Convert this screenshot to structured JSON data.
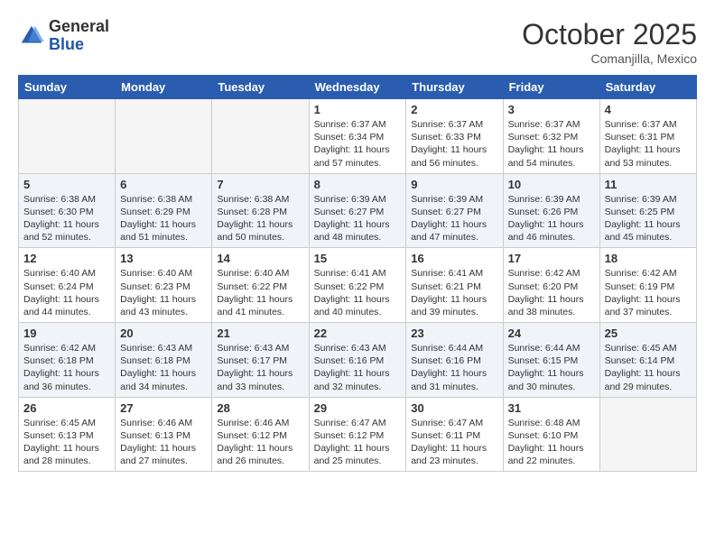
{
  "logo": {
    "general": "General",
    "blue": "Blue"
  },
  "title": "October 2025",
  "subtitle": "Comanjilla, Mexico",
  "weekdays": [
    "Sunday",
    "Monday",
    "Tuesday",
    "Wednesday",
    "Thursday",
    "Friday",
    "Saturday"
  ],
  "weeks": [
    [
      {
        "day": "",
        "sunrise": "",
        "sunset": "",
        "daylight": ""
      },
      {
        "day": "",
        "sunrise": "",
        "sunset": "",
        "daylight": ""
      },
      {
        "day": "",
        "sunrise": "",
        "sunset": "",
        "daylight": ""
      },
      {
        "day": "1",
        "sunrise": "Sunrise: 6:37 AM",
        "sunset": "Sunset: 6:34 PM",
        "daylight": "Daylight: 11 hours and 57 minutes."
      },
      {
        "day": "2",
        "sunrise": "Sunrise: 6:37 AM",
        "sunset": "Sunset: 6:33 PM",
        "daylight": "Daylight: 11 hours and 56 minutes."
      },
      {
        "day": "3",
        "sunrise": "Sunrise: 6:37 AM",
        "sunset": "Sunset: 6:32 PM",
        "daylight": "Daylight: 11 hours and 54 minutes."
      },
      {
        "day": "4",
        "sunrise": "Sunrise: 6:37 AM",
        "sunset": "Sunset: 6:31 PM",
        "daylight": "Daylight: 11 hours and 53 minutes."
      }
    ],
    [
      {
        "day": "5",
        "sunrise": "Sunrise: 6:38 AM",
        "sunset": "Sunset: 6:30 PM",
        "daylight": "Daylight: 11 hours and 52 minutes."
      },
      {
        "day": "6",
        "sunrise": "Sunrise: 6:38 AM",
        "sunset": "Sunset: 6:29 PM",
        "daylight": "Daylight: 11 hours and 51 minutes."
      },
      {
        "day": "7",
        "sunrise": "Sunrise: 6:38 AM",
        "sunset": "Sunset: 6:28 PM",
        "daylight": "Daylight: 11 hours and 50 minutes."
      },
      {
        "day": "8",
        "sunrise": "Sunrise: 6:39 AM",
        "sunset": "Sunset: 6:27 PM",
        "daylight": "Daylight: 11 hours and 48 minutes."
      },
      {
        "day": "9",
        "sunrise": "Sunrise: 6:39 AM",
        "sunset": "Sunset: 6:27 PM",
        "daylight": "Daylight: 11 hours and 47 minutes."
      },
      {
        "day": "10",
        "sunrise": "Sunrise: 6:39 AM",
        "sunset": "Sunset: 6:26 PM",
        "daylight": "Daylight: 11 hours and 46 minutes."
      },
      {
        "day": "11",
        "sunrise": "Sunrise: 6:39 AM",
        "sunset": "Sunset: 6:25 PM",
        "daylight": "Daylight: 11 hours and 45 minutes."
      }
    ],
    [
      {
        "day": "12",
        "sunrise": "Sunrise: 6:40 AM",
        "sunset": "Sunset: 6:24 PM",
        "daylight": "Daylight: 11 hours and 44 minutes."
      },
      {
        "day": "13",
        "sunrise": "Sunrise: 6:40 AM",
        "sunset": "Sunset: 6:23 PM",
        "daylight": "Daylight: 11 hours and 43 minutes."
      },
      {
        "day": "14",
        "sunrise": "Sunrise: 6:40 AM",
        "sunset": "Sunset: 6:22 PM",
        "daylight": "Daylight: 11 hours and 41 minutes."
      },
      {
        "day": "15",
        "sunrise": "Sunrise: 6:41 AM",
        "sunset": "Sunset: 6:22 PM",
        "daylight": "Daylight: 11 hours and 40 minutes."
      },
      {
        "day": "16",
        "sunrise": "Sunrise: 6:41 AM",
        "sunset": "Sunset: 6:21 PM",
        "daylight": "Daylight: 11 hours and 39 minutes."
      },
      {
        "day": "17",
        "sunrise": "Sunrise: 6:42 AM",
        "sunset": "Sunset: 6:20 PM",
        "daylight": "Daylight: 11 hours and 38 minutes."
      },
      {
        "day": "18",
        "sunrise": "Sunrise: 6:42 AM",
        "sunset": "Sunset: 6:19 PM",
        "daylight": "Daylight: 11 hours and 37 minutes."
      }
    ],
    [
      {
        "day": "19",
        "sunrise": "Sunrise: 6:42 AM",
        "sunset": "Sunset: 6:18 PM",
        "daylight": "Daylight: 11 hours and 36 minutes."
      },
      {
        "day": "20",
        "sunrise": "Sunrise: 6:43 AM",
        "sunset": "Sunset: 6:18 PM",
        "daylight": "Daylight: 11 hours and 34 minutes."
      },
      {
        "day": "21",
        "sunrise": "Sunrise: 6:43 AM",
        "sunset": "Sunset: 6:17 PM",
        "daylight": "Daylight: 11 hours and 33 minutes."
      },
      {
        "day": "22",
        "sunrise": "Sunrise: 6:43 AM",
        "sunset": "Sunset: 6:16 PM",
        "daylight": "Daylight: 11 hours and 32 minutes."
      },
      {
        "day": "23",
        "sunrise": "Sunrise: 6:44 AM",
        "sunset": "Sunset: 6:16 PM",
        "daylight": "Daylight: 11 hours and 31 minutes."
      },
      {
        "day": "24",
        "sunrise": "Sunrise: 6:44 AM",
        "sunset": "Sunset: 6:15 PM",
        "daylight": "Daylight: 11 hours and 30 minutes."
      },
      {
        "day": "25",
        "sunrise": "Sunrise: 6:45 AM",
        "sunset": "Sunset: 6:14 PM",
        "daylight": "Daylight: 11 hours and 29 minutes."
      }
    ],
    [
      {
        "day": "26",
        "sunrise": "Sunrise: 6:45 AM",
        "sunset": "Sunset: 6:13 PM",
        "daylight": "Daylight: 11 hours and 28 minutes."
      },
      {
        "day": "27",
        "sunrise": "Sunrise: 6:46 AM",
        "sunset": "Sunset: 6:13 PM",
        "daylight": "Daylight: 11 hours and 27 minutes."
      },
      {
        "day": "28",
        "sunrise": "Sunrise: 6:46 AM",
        "sunset": "Sunset: 6:12 PM",
        "daylight": "Daylight: 11 hours and 26 minutes."
      },
      {
        "day": "29",
        "sunrise": "Sunrise: 6:47 AM",
        "sunset": "Sunset: 6:12 PM",
        "daylight": "Daylight: 11 hours and 25 minutes."
      },
      {
        "day": "30",
        "sunrise": "Sunrise: 6:47 AM",
        "sunset": "Sunset: 6:11 PM",
        "daylight": "Daylight: 11 hours and 23 minutes."
      },
      {
        "day": "31",
        "sunrise": "Sunrise: 6:48 AM",
        "sunset": "Sunset: 6:10 PM",
        "daylight": "Daylight: 11 hours and 22 minutes."
      },
      {
        "day": "",
        "sunrise": "",
        "sunset": "",
        "daylight": ""
      }
    ]
  ]
}
